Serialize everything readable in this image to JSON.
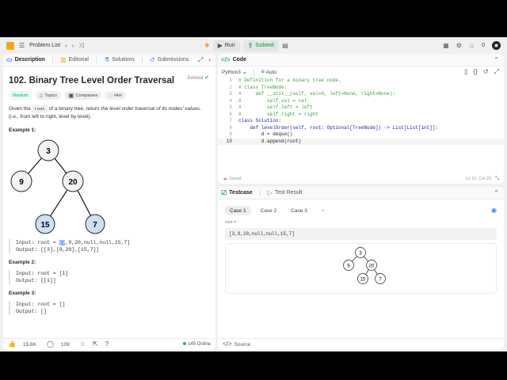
{
  "topbar": {
    "problem_list": "Problem List",
    "run": "Run",
    "submit": "Submit",
    "streak": "0"
  },
  "left": {
    "tabs": [
      "Description",
      "Editorial",
      "Solutions",
      "Submissions"
    ],
    "title": "102. Binary Tree Level Order Traversal",
    "solved": "Solved",
    "difficulty": "Medium",
    "badges": [
      "Topics",
      "Companies",
      "Hint"
    ],
    "desc_pre": "Given the ",
    "desc_code": "root",
    "desc_mid": " of a binary tree, return ",
    "desc_em": "the level order traversal of its nodes' values",
    "desc_post": ". (i.e., from left to right, level by level).",
    "example1_title": "Example 1:",
    "tree1": [
      "3",
      "9",
      "20",
      "15",
      "7"
    ],
    "ex1_input_label": "Input: root = ",
    "ex1_caret": "[3",
    "ex1_input_rest": ",9,20,null,null,15,7]",
    "ex1_output": "Output: [[3],[9,20],[15,7]]",
    "example2_title": "Example 2:",
    "ex2_input": "Input: root = [1]",
    "ex2_output": "Output: [[1]]",
    "example3_title": "Example 3:",
    "ex3_input": "Input: root = []",
    "ex3_output": "Output: []",
    "likes": "15.6K",
    "comments": "109",
    "online": "145 Online"
  },
  "code": {
    "tab": "Code",
    "language": "Python3",
    "mode": "Auto",
    "line_numbers": [
      "1",
      "2",
      "3",
      "4",
      "5",
      "6",
      "7",
      "8",
      "9",
      "10"
    ],
    "lines": [
      "# Definition for a binary tree node.",
      "# class TreeNode:",
      "#     def __init__(self, val=0, left=None, right=None):",
      "#         self.val = val",
      "#         self.left = left",
      "#         self.right = right",
      "class Solution:",
      "    def levelOrder(self, root: Optional[TreeNode]) -> List[List[int]]:",
      "        d = deque()",
      "        d.append(root)"
    ],
    "saved": "Saved",
    "cursor": "Ln 10, Col 23"
  },
  "test": {
    "tab_testcase": "Testcase",
    "tab_result": "Test Result",
    "cases": [
      "Case 1",
      "Case 2",
      "Case 3"
    ],
    "add": "+",
    "root_label": "root =",
    "root_value": "[3,9,20,null,null,15,7]",
    "tree": [
      "3",
      "9",
      "20",
      "15",
      "7"
    ],
    "source": "Source"
  },
  "colors": {
    "accent_green": "#2db55d",
    "medium": "#00a88f",
    "node_highlight": "#cfe0f5",
    "caret": "#7aa7ff"
  }
}
